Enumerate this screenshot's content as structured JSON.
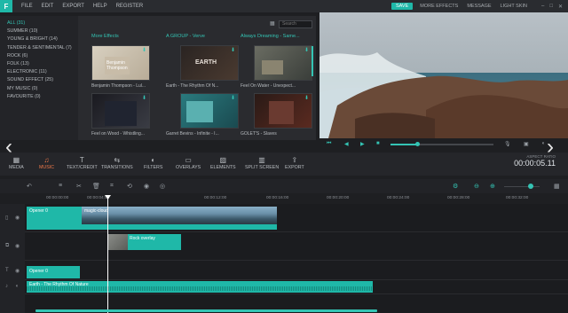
{
  "menubar": {
    "items": [
      "FILE",
      "EDIT",
      "EXPORT",
      "HELP",
      "REGISTER"
    ],
    "save": "SAVE",
    "right_items": [
      "MORE EFFECTS",
      "MESSAGE",
      "LIGHT SKIN"
    ]
  },
  "sidebar": {
    "categories": [
      "ALL (31)",
      "SUMMER (10)",
      "YOUNG & BRIGHT (14)",
      "TENDER & SENTIMENTAL (7)",
      "ROCK (6)",
      "FOLK (13)",
      "ELECTRONIC (11)",
      "SOUND EFFECT (25)",
      "MY MUSIC (0)",
      "FAVOURITE (0)"
    ]
  },
  "library": {
    "search_placeholder": "Search",
    "sections": [
      "More Effects",
      "A GROUP - Verve",
      "Always Dreaming - Same..."
    ],
    "items": [
      {
        "label": "Benjamin Thompson - Lul..."
      },
      {
        "label": "Earth - The Rhythm Of N..."
      },
      {
        "label": "Feel On Water - Unexpect..."
      },
      {
        "label": "Feel on Wood - Whistling..."
      },
      {
        "label": "Garret Bevins - Infinite - I..."
      },
      {
        "label": "GOLET'S - Slaves"
      }
    ],
    "thumb_texts": [
      "Benjamin\nThompson",
      "EARTH",
      ""
    ]
  },
  "toolbar": {
    "tools": [
      "MEDIA",
      "MUSIC",
      "TEXT/CREDIT",
      "TRANSITIONS",
      "FILTERS",
      "OVERLAYS",
      "ELEMENTS",
      "SPLIT SCREEN",
      "EXPORT"
    ],
    "active": "MUSIC",
    "aspect_label": "ASPECT RATIO",
    "timecode": "00:00:05.11"
  },
  "timeline": {
    "ticks": [
      "00:00:00:00",
      "00:00:04:00",
      "00:00:08:00",
      "00:00:12:00",
      "00:00:16:00",
      "00:00:20:00",
      "00:00:24:00",
      "00:00:28:00",
      "00:00:32:00"
    ],
    "clips": {
      "title_clip": "Opener 0",
      "video_clip": "magic-cloud",
      "overlay_clip": "Rock overlay",
      "text_clip": "Opener 0",
      "audio_clip": "Earth - The Rhythm Of Nature"
    }
  },
  "colors": {
    "accent": "#1fb8a8",
    "active_tool": "#f07a4a",
    "background": "#1e1f22"
  }
}
